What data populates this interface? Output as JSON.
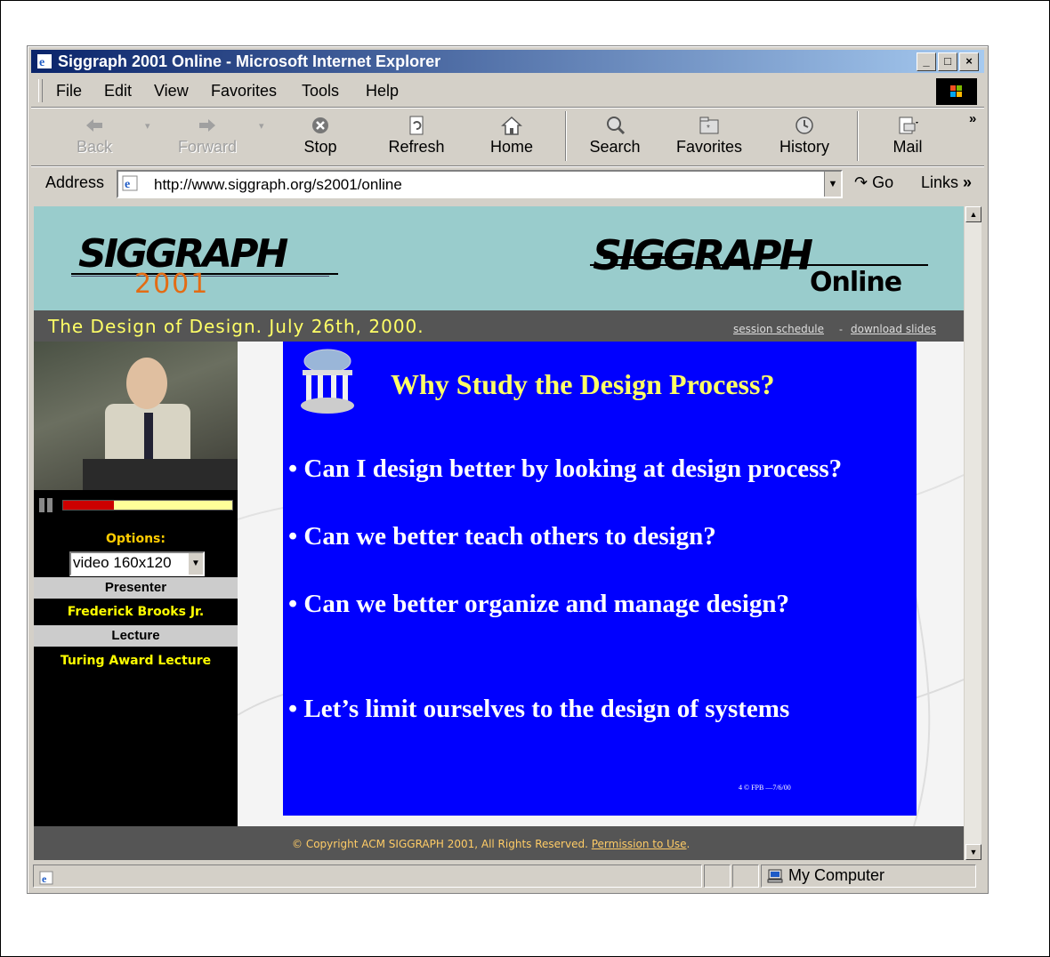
{
  "window": {
    "title": "Siggraph 2001 Online - Microsoft Internet Explorer",
    "controls": [
      "_",
      "□",
      "×"
    ]
  },
  "menu": [
    "File",
    "Edit",
    "View",
    "Favorites",
    "Tools",
    "Help"
  ],
  "toolbar": {
    "back": "Back",
    "forward": "Forward",
    "stop": "Stop",
    "refresh": "Refresh",
    "home": "Home",
    "search": "Search",
    "favorites": "Favorites",
    "history": "History",
    "mail": "Mail",
    "more": "»"
  },
  "address": {
    "label": "Address",
    "url": "http://www.siggraph.org/s2001/online",
    "go": "Go",
    "links": "Links",
    "links_more": "»"
  },
  "header": {
    "logo_left": "SIGGRAPH",
    "logo_year": "2001",
    "logo_right": "SIGGRAPH",
    "logo_online": "Online"
  },
  "subheader": {
    "tagline": "The Design of Design. July 26th, 2000.",
    "session_schedule": "session schedule",
    "separator": "-",
    "download_slides": "download slides"
  },
  "player": {
    "progress": 0.3,
    "options_label": "Options:",
    "options_value": "video 160x120",
    "presenter_label": "Presenter",
    "presenter_name": "Frederick Brooks Jr.",
    "lecture_label": "Lecture",
    "lecture_name": "Turing Award Lecture"
  },
  "slide": {
    "title": "Why Study the Design Process?",
    "bullets": [
      "• Can I design better by looking at design process?",
      "• Can we better teach others to  design?",
      "• Can we better organize and manage design?",
      "• Let’s limit ourselves to the design of systems"
    ],
    "footnote": "4   © FPB —7/6/00"
  },
  "footer": {
    "copyright": "© Copyright ACM SIGGRAPH 2001, All Rights Reserved.",
    "permission": "Permission to Use"
  },
  "status": {
    "zone": "My Computer"
  }
}
